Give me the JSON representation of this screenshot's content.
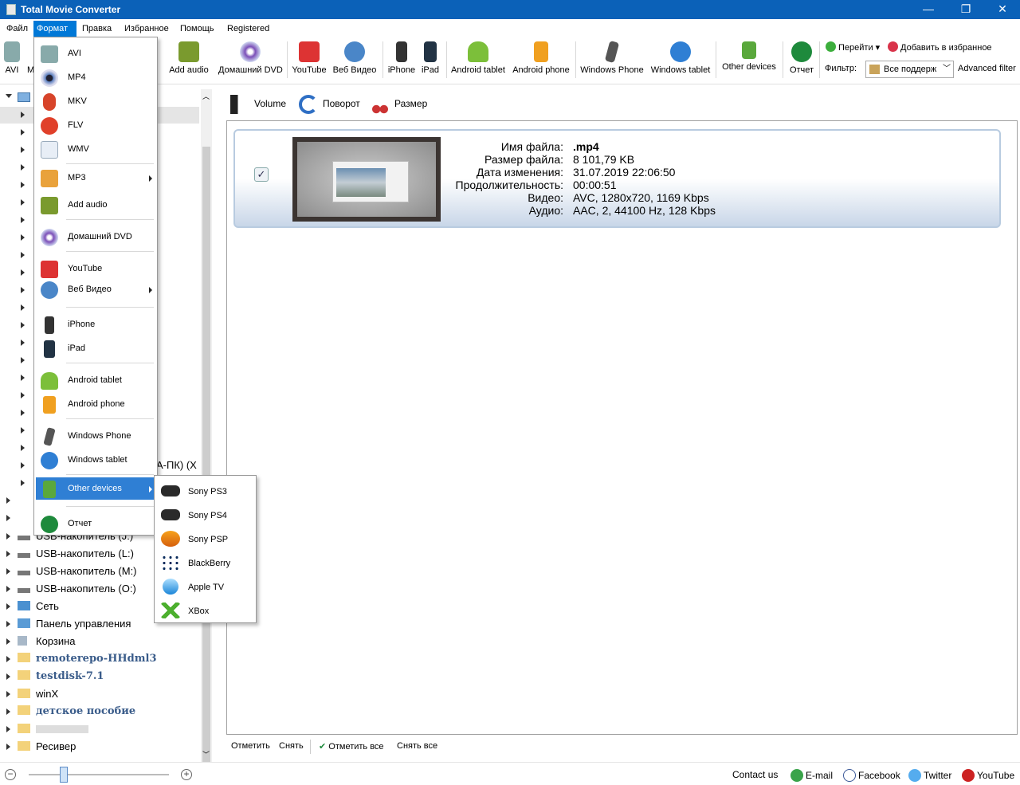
{
  "window": {
    "title": "Total Movie Converter",
    "minimize": "—",
    "restore": "❐",
    "close": "✕"
  },
  "menubar": [
    "Файл",
    "Формат",
    "Правка",
    "Избранное",
    "Помощь",
    "Registered"
  ],
  "toolbar": {
    "left_partial": [
      "AVI",
      "M"
    ],
    "buttons": [
      "Add audio",
      "Домашний DVD",
      "YouTube",
      "Веб Видео",
      "iPhone",
      "iPad",
      "Android tablet",
      "Android phone",
      "Windows Phone",
      "Windows tablet",
      "Other devices",
      "Отчет"
    ],
    "goto": "Перейти",
    "add_fav": "Добавить в избранное",
    "filter_label": "Фильтр:",
    "filter_value": "Все поддерж",
    "advanced_filter": "Advanced filter"
  },
  "format_menu": [
    "AVI",
    "MP4",
    "MKV",
    "FLV",
    "WMV",
    "MP3",
    "Add audio",
    "Домашний DVD",
    "YouTube",
    "Веб Видео",
    "iPhone",
    "iPad",
    "Android tablet",
    "Android phone",
    "Windows Phone",
    "Windows tablet",
    "Other devices",
    "Отчет"
  ],
  "other_devices_menu": [
    "Sony PS3",
    "Sony PS4",
    "Sony PSP",
    "BlackBerry",
    "Apple TV",
    "XBox"
  ],
  "tree": {
    "partial_text": "А-ПК) (X",
    "items": [
      "USB-накопитель (J:)",
      "USB-накопитель (L:)",
      "USB-накопитель (M:)",
      "USB-накопитель (O:)",
      "Сеть",
      "Панель управления",
      "Корзина",
      "remoterepo-HHdml3",
      "testdisk-7.1",
      "winX",
      "детское пособие",
      "",
      "Ресивер"
    ]
  },
  "subtoolbar": {
    "volume": "Volume",
    "rotate": "Поворот",
    "size": "Размер"
  },
  "file": {
    "check": "✓",
    "labels": [
      "Имя файла:",
      "Размер файла:",
      "Дата изменения:",
      "Продолжительность:",
      "Видео:",
      "Аудио:"
    ],
    "values": [
      ".mp4",
      "8 101,79 KB",
      "31.07.2019 22:06:50",
      "00:00:51",
      "AVC, 1280x720, 1169 Kbps",
      "AAC, 2, 44100 Hz, 128 Kbps"
    ]
  },
  "bottombar": {
    "mark": "Отметить",
    "unmark": "Снять",
    "mark_all": "Отметить все",
    "unmark_all": "Снять все"
  },
  "statusbar": {
    "zoom_minus": "−",
    "zoom_plus": "+",
    "zoom_level": 0.25,
    "contact": "Contact us",
    "email": "E-mail",
    "facebook": "Facebook",
    "twitter": "Twitter",
    "youtube": "YouTube"
  },
  "colors": {
    "titlebar": "#0b61b8",
    "menu_highlight": "#2f7fd4",
    "menu_active": "#0078d7"
  }
}
